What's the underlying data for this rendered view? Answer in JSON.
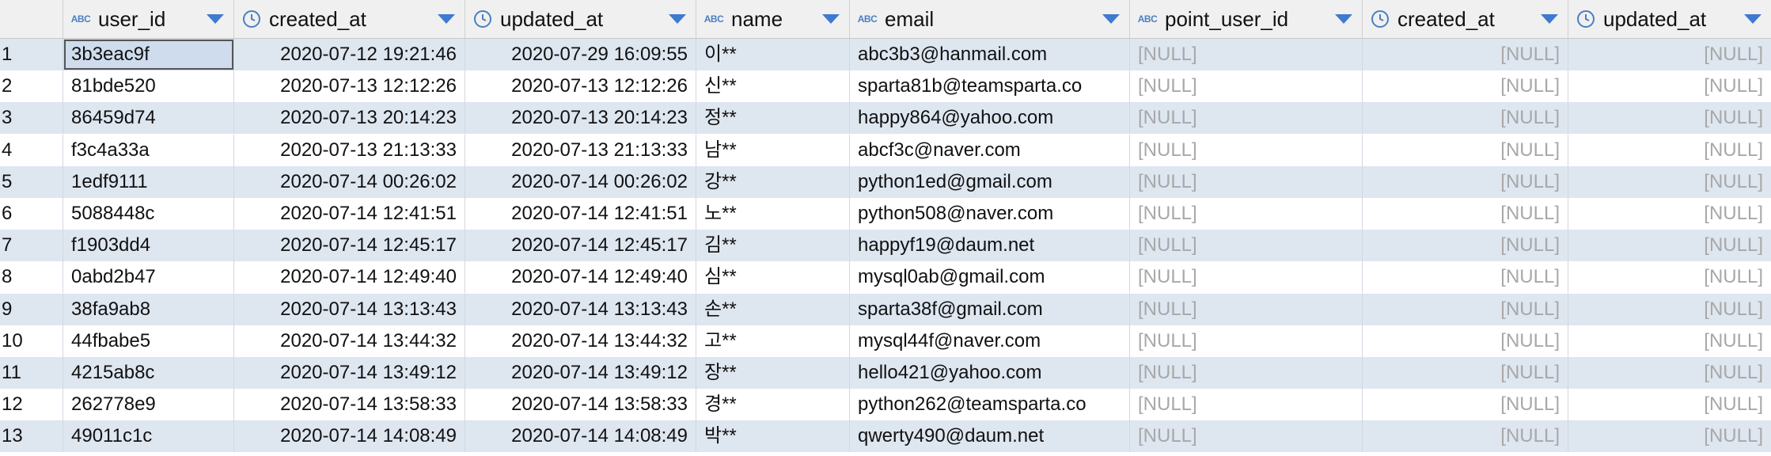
{
  "columns": [
    {
      "name": "user_id",
      "type": "ABC"
    },
    {
      "name": "created_at",
      "type": "clock"
    },
    {
      "name": "updated_at",
      "type": "clock"
    },
    {
      "name": "name",
      "type": "ABC"
    },
    {
      "name": "email",
      "type": "ABC"
    },
    {
      "name": "point_user_id",
      "type": "ABC"
    },
    {
      "name": "created_at",
      "type": "clock"
    },
    {
      "name": "updated_at",
      "type": "clock"
    }
  ],
  "abc_label": "ABC",
  "null_text": "[NULL]",
  "rows": [
    {
      "n": "1",
      "user_id": "3b3eac9f",
      "created_at": "2020-07-12 19:21:46",
      "updated_at": "2020-07-29 16:09:55",
      "name": "이**",
      "email": "abc3b3@hanmail.com"
    },
    {
      "n": "2",
      "user_id": "81bde520",
      "created_at": "2020-07-13 12:12:26",
      "updated_at": "2020-07-13 12:12:26",
      "name": "신**",
      "email": "sparta81b@teamsparta.co"
    },
    {
      "n": "3",
      "user_id": "86459d74",
      "created_at": "2020-07-13 20:14:23",
      "updated_at": "2020-07-13 20:14:23",
      "name": "정**",
      "email": "happy864@yahoo.com"
    },
    {
      "n": "4",
      "user_id": "f3c4a33a",
      "created_at": "2020-07-13 21:13:33",
      "updated_at": "2020-07-13 21:13:33",
      "name": "남**",
      "email": "abcf3c@naver.com"
    },
    {
      "n": "5",
      "user_id": "1edf9111",
      "created_at": "2020-07-14 00:26:02",
      "updated_at": "2020-07-14 00:26:02",
      "name": "강**",
      "email": "python1ed@gmail.com"
    },
    {
      "n": "6",
      "user_id": "5088448c",
      "created_at": "2020-07-14 12:41:51",
      "updated_at": "2020-07-14 12:41:51",
      "name": "노**",
      "email": "python508@naver.com"
    },
    {
      "n": "7",
      "user_id": "f1903dd4",
      "created_at": "2020-07-14 12:45:17",
      "updated_at": "2020-07-14 12:45:17",
      "name": "김**",
      "email": "happyf19@daum.net"
    },
    {
      "n": "8",
      "user_id": "0abd2b47",
      "created_at": "2020-07-14 12:49:40",
      "updated_at": "2020-07-14 12:49:40",
      "name": "심**",
      "email": "mysql0ab@gmail.com"
    },
    {
      "n": "9",
      "user_id": "38fa9ab8",
      "created_at": "2020-07-14 13:13:43",
      "updated_at": "2020-07-14 13:13:43",
      "name": "손**",
      "email": "sparta38f@gmail.com"
    },
    {
      "n": "10",
      "user_id": "44fbabe5",
      "created_at": "2020-07-14 13:44:32",
      "updated_at": "2020-07-14 13:44:32",
      "name": "고**",
      "email": "mysql44f@naver.com"
    },
    {
      "n": "11",
      "user_id": "4215ab8c",
      "created_at": "2020-07-14 13:49:12",
      "updated_at": "2020-07-14 13:49:12",
      "name": "장**",
      "email": "hello421@yahoo.com"
    },
    {
      "n": "12",
      "user_id": "262778e9",
      "created_at": "2020-07-14 13:58:33",
      "updated_at": "2020-07-14 13:58:33",
      "name": "경**",
      "email": "python262@teamsparta.co"
    },
    {
      "n": "13",
      "user_id": "49011c1c",
      "created_at": "2020-07-14 14:08:49",
      "updated_at": "2020-07-14 14:08:49",
      "name": "박**",
      "email": "qwerty490@daum.net"
    }
  ]
}
